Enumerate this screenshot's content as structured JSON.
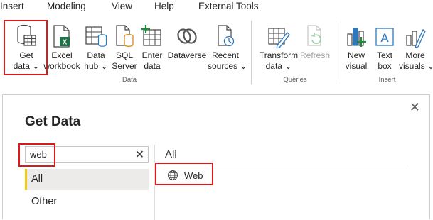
{
  "menu": [
    "Insert",
    "Modeling",
    "View",
    "Help",
    "External Tools"
  ],
  "ribbon": {
    "data_group": {
      "label": "Data",
      "buttons": [
        {
          "line1": "Get",
          "line2": "data ⌄"
        },
        {
          "line1": "Excel",
          "line2": "workbook"
        },
        {
          "line1": "Data",
          "line2": "hub ⌄"
        },
        {
          "line1": "SQL",
          "line2": "Server"
        },
        {
          "line1": "Enter",
          "line2": "data"
        },
        {
          "line1": "Dataverse",
          "line2": ""
        },
        {
          "line1": "Recent",
          "line2": "sources ⌄"
        }
      ]
    },
    "queries_group": {
      "label": "Queries",
      "buttons": [
        {
          "line1": "Transform",
          "line2": "data ⌄"
        },
        {
          "line1": "Refresh",
          "line2": "",
          "disabled": true
        }
      ]
    },
    "insert_group": {
      "label": "Insert",
      "buttons": [
        {
          "line1": "New",
          "line2": "visual"
        },
        {
          "line1": "Text",
          "line2": "box"
        },
        {
          "line1": "More",
          "line2": "visuals ⌄"
        }
      ]
    }
  },
  "dialog": {
    "title": "Get Data",
    "close_glyph": "✕",
    "search": {
      "value": "web",
      "clear_glyph": "✕"
    },
    "categories": [
      {
        "label": "All",
        "selected": true
      },
      {
        "label": "Other",
        "selected": false
      }
    ],
    "results_header": "All",
    "results": [
      {
        "label": "Web",
        "icon": "globe-icon"
      }
    ]
  },
  "colors": {
    "highlight": "#d91b1b",
    "accent_yellow": "#f2c811",
    "excel_green": "#1e7145",
    "blue": "#2b79c2"
  }
}
